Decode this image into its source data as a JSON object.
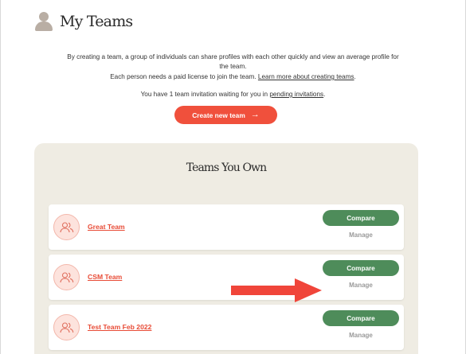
{
  "header": {
    "title": "My Teams",
    "icon": "person-icon"
  },
  "intro": {
    "line1": "By creating a team, a group of individuals can share profiles with each other quickly and view an average profile for the team.",
    "line2_text": "Each person needs a paid license to join the team. ",
    "line2_link": "Learn more about creating teams",
    "line2_end": ".",
    "line3_text": "You have 1 team invitation waiting for you in ",
    "line3_link": "pending invitations",
    "line3_end": "."
  },
  "create_button": {
    "label": "Create new team",
    "arrow": "→"
  },
  "panel": {
    "title": "Teams You Own"
  },
  "teams": [
    {
      "name": "Great Team",
      "compare": "Compare",
      "manage": "Manage"
    },
    {
      "name": "CSM Team",
      "compare": "Compare",
      "manage": "Manage"
    },
    {
      "name": "Test Team Feb 2022",
      "compare": "Compare",
      "manage": "Manage"
    }
  ],
  "colors": {
    "accent": "#f0503c",
    "compare": "#4e8c5a",
    "panel": "#efece3",
    "annotation_arrow": "#f0453a"
  }
}
